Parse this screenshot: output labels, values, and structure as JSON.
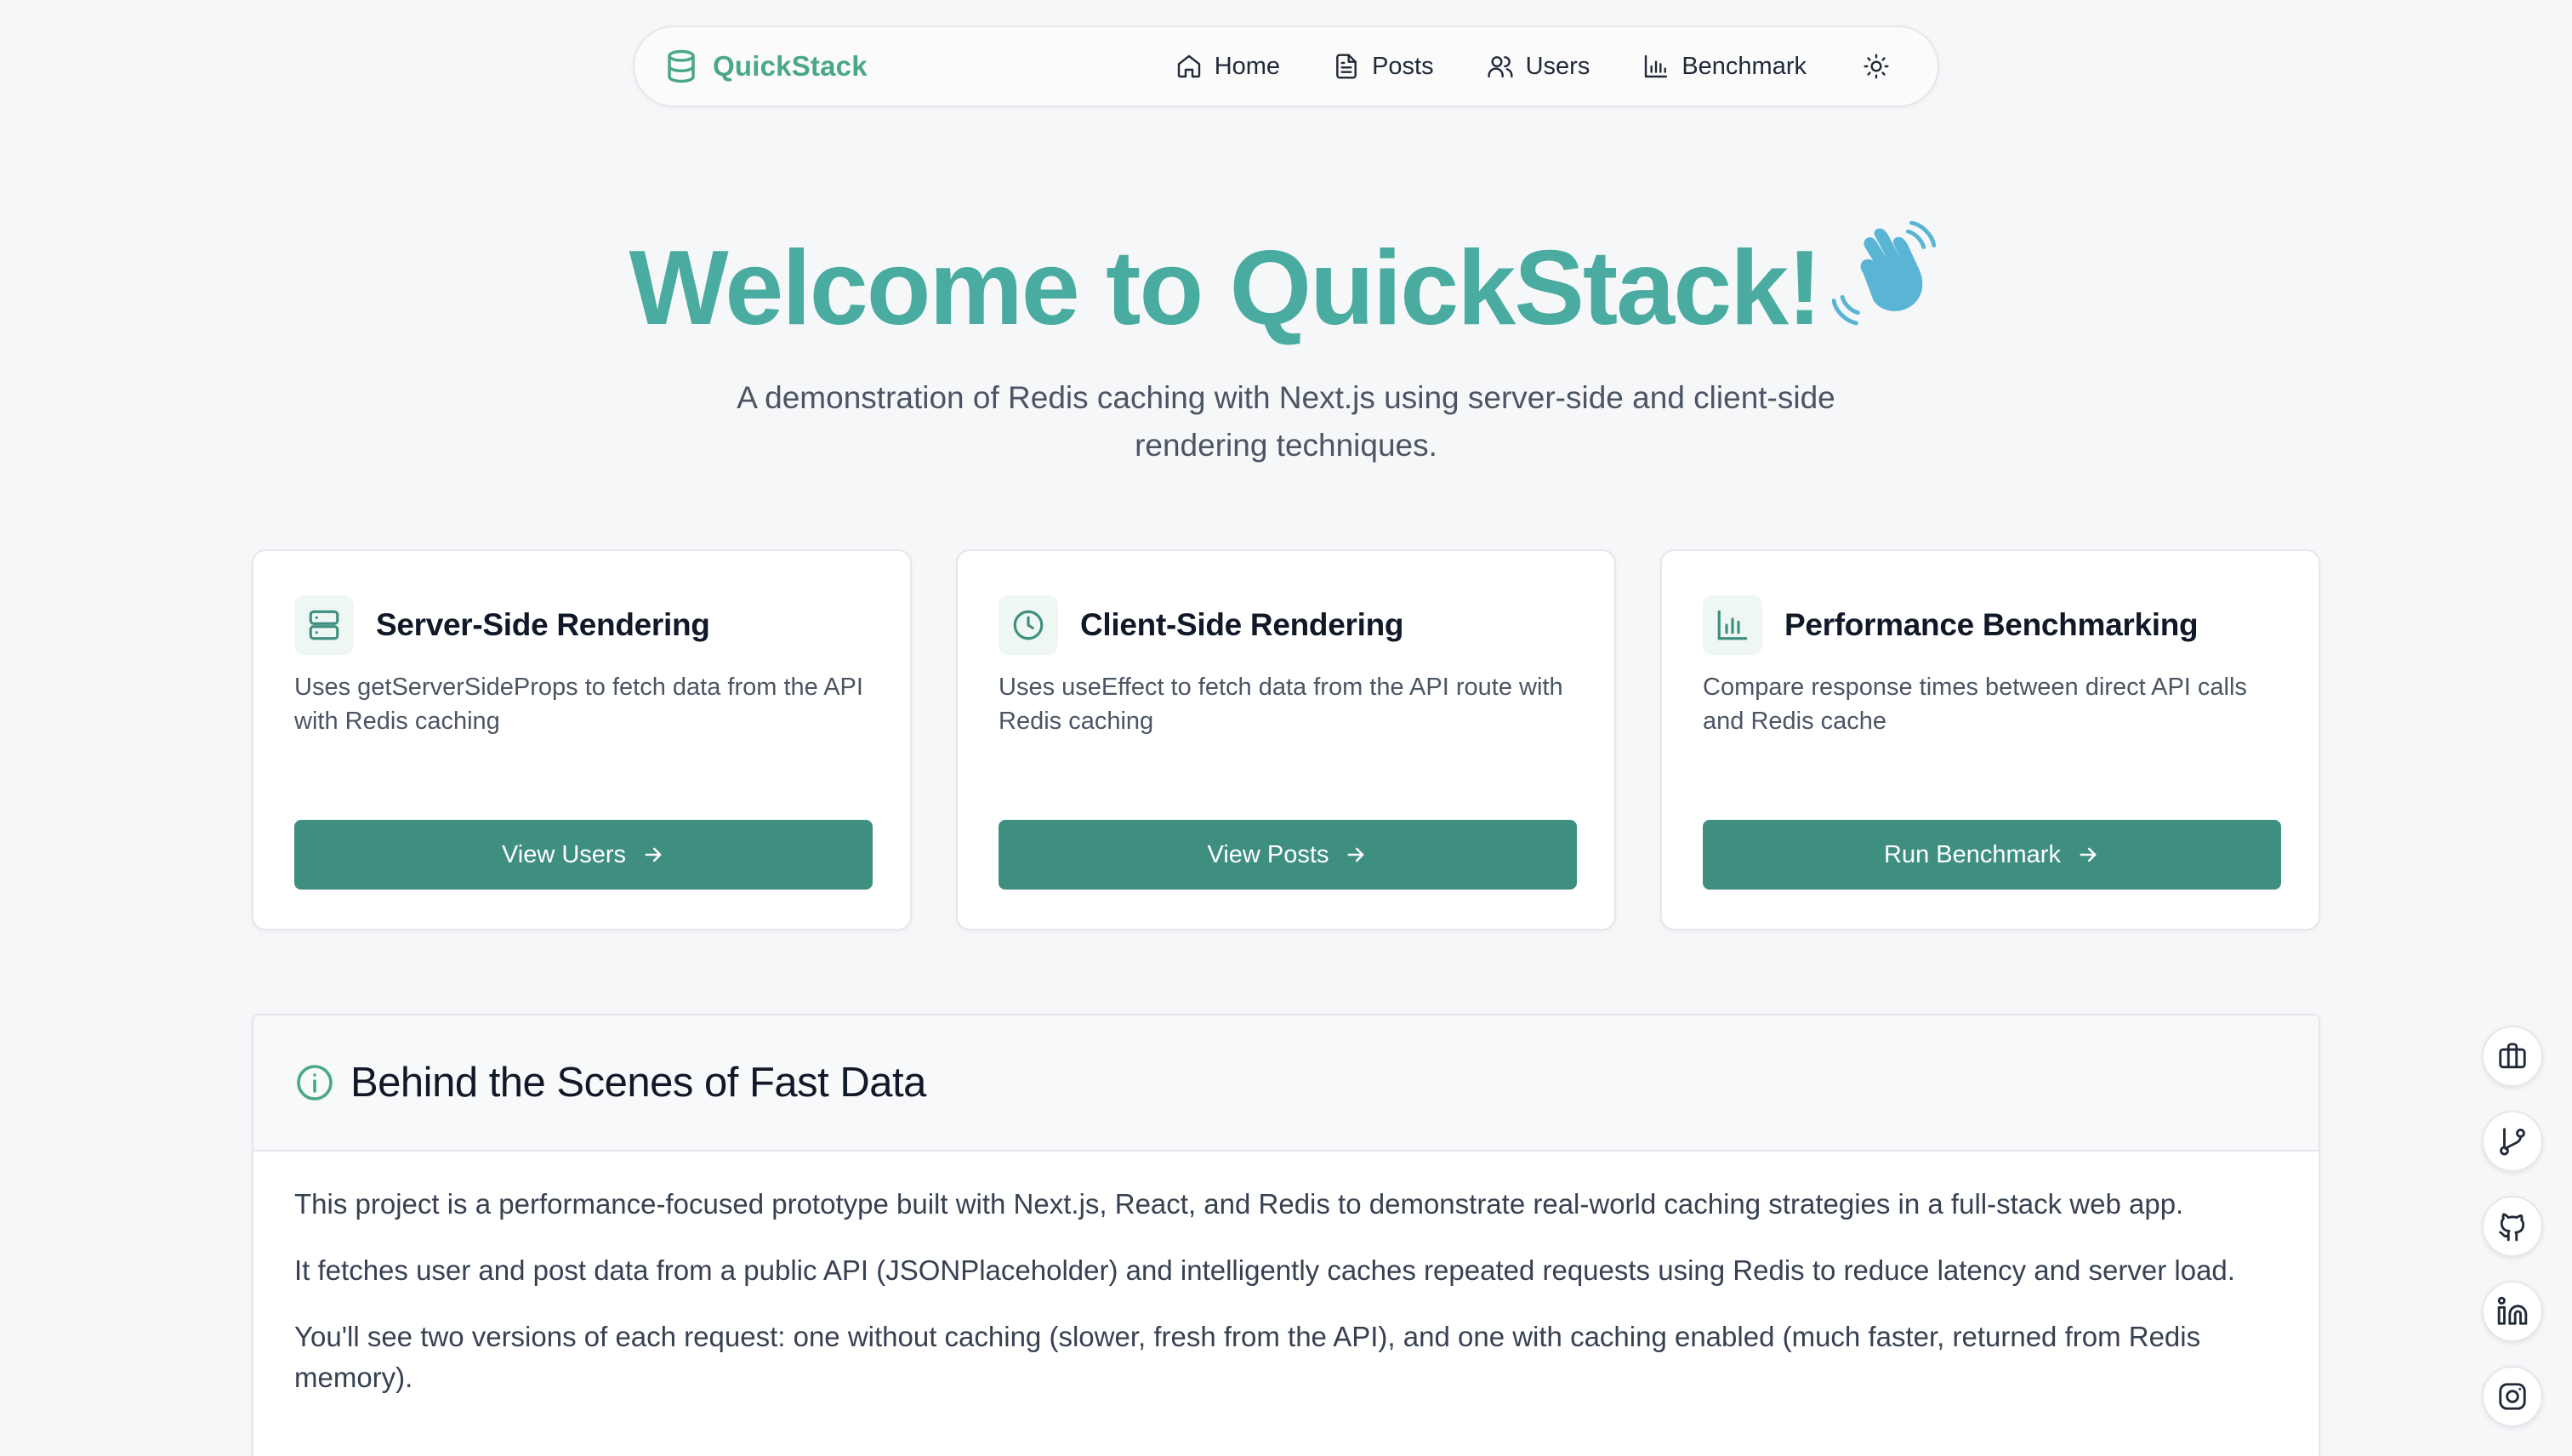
{
  "nav": {
    "brand": "QuickStack",
    "links": [
      {
        "label": "Home",
        "icon": "home-icon"
      },
      {
        "label": "Posts",
        "icon": "file-text-icon"
      },
      {
        "label": "Users",
        "icon": "users-icon"
      },
      {
        "label": "Benchmark",
        "icon": "bar-chart-icon"
      }
    ],
    "theme_toggle_icon": "sun-icon"
  },
  "hero": {
    "title": "Welcome to QuickStack!",
    "emoji_icon": "waving-hand-icon",
    "subtitle": "A demonstration of Redis caching with Next.js using server-side and client-side rendering techniques."
  },
  "cards": [
    {
      "title": "Server-Side Rendering",
      "icon": "server-icon",
      "description": "Uses getServerSideProps to fetch data from the API with Redis caching",
      "button": "View Users"
    },
    {
      "title": "Client-Side Rendering",
      "icon": "clock-icon",
      "description": "Uses useEffect to fetch data from the API route with Redis caching",
      "button": "View Posts"
    },
    {
      "title": "Performance Benchmarking",
      "icon": "bar-chart-icon",
      "description": "Compare response times between direct API calls and Redis cache",
      "button": "Run Benchmark"
    }
  ],
  "info": {
    "title": "Behind the Scenes of Fast Data",
    "icon": "info-icon",
    "paragraphs": [
      "This project is a performance-focused prototype built with Next.js, React, and Redis to demonstrate real-world caching strategies in a full-stack web app.",
      "It fetches user and post data from a public API (JSONPlaceholder) and intelligently caches repeated requests using Redis to reduce latency and server load.",
      "You'll see two versions of each request: one without caching (slower, fresh from the API), and one with caching enabled (much faster, returned from Redis memory)."
    ]
  },
  "social": [
    {
      "name": "portfolio",
      "icon": "briefcase-icon"
    },
    {
      "name": "git",
      "icon": "git-branch-icon"
    },
    {
      "name": "github",
      "icon": "github-icon"
    },
    {
      "name": "linkedin",
      "icon": "linkedin-icon"
    },
    {
      "name": "instagram",
      "icon": "instagram-icon"
    }
  ],
  "colors": {
    "accent": "#4aa887",
    "title": "#4aaca0",
    "button": "#3f8f81",
    "background": "#f6f7f9"
  }
}
